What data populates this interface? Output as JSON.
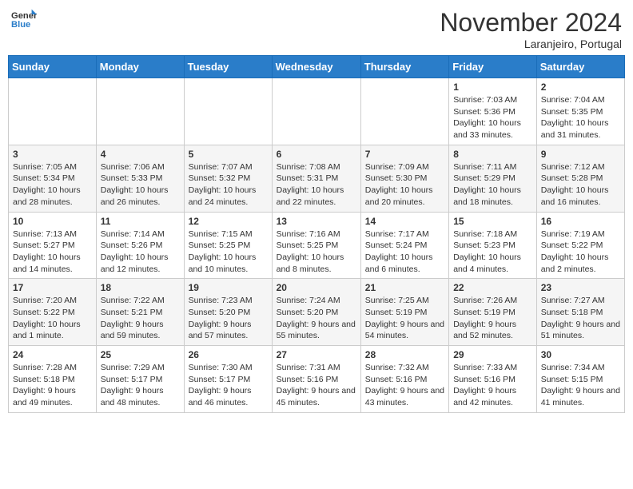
{
  "header": {
    "logo_general": "General",
    "logo_blue": "Blue",
    "month": "November 2024",
    "location": "Laranjeiro, Portugal"
  },
  "days_of_week": [
    "Sunday",
    "Monday",
    "Tuesday",
    "Wednesday",
    "Thursday",
    "Friday",
    "Saturday"
  ],
  "weeks": [
    [
      {
        "day": "",
        "info": ""
      },
      {
        "day": "",
        "info": ""
      },
      {
        "day": "",
        "info": ""
      },
      {
        "day": "",
        "info": ""
      },
      {
        "day": "",
        "info": ""
      },
      {
        "day": "1",
        "info": "Sunrise: 7:03 AM\nSunset: 5:36 PM\nDaylight: 10 hours and 33 minutes."
      },
      {
        "day": "2",
        "info": "Sunrise: 7:04 AM\nSunset: 5:35 PM\nDaylight: 10 hours and 31 minutes."
      }
    ],
    [
      {
        "day": "3",
        "info": "Sunrise: 7:05 AM\nSunset: 5:34 PM\nDaylight: 10 hours and 28 minutes."
      },
      {
        "day": "4",
        "info": "Sunrise: 7:06 AM\nSunset: 5:33 PM\nDaylight: 10 hours and 26 minutes."
      },
      {
        "day": "5",
        "info": "Sunrise: 7:07 AM\nSunset: 5:32 PM\nDaylight: 10 hours and 24 minutes."
      },
      {
        "day": "6",
        "info": "Sunrise: 7:08 AM\nSunset: 5:31 PM\nDaylight: 10 hours and 22 minutes."
      },
      {
        "day": "7",
        "info": "Sunrise: 7:09 AM\nSunset: 5:30 PM\nDaylight: 10 hours and 20 minutes."
      },
      {
        "day": "8",
        "info": "Sunrise: 7:11 AM\nSunset: 5:29 PM\nDaylight: 10 hours and 18 minutes."
      },
      {
        "day": "9",
        "info": "Sunrise: 7:12 AM\nSunset: 5:28 PM\nDaylight: 10 hours and 16 minutes."
      }
    ],
    [
      {
        "day": "10",
        "info": "Sunrise: 7:13 AM\nSunset: 5:27 PM\nDaylight: 10 hours and 14 minutes."
      },
      {
        "day": "11",
        "info": "Sunrise: 7:14 AM\nSunset: 5:26 PM\nDaylight: 10 hours and 12 minutes."
      },
      {
        "day": "12",
        "info": "Sunrise: 7:15 AM\nSunset: 5:25 PM\nDaylight: 10 hours and 10 minutes."
      },
      {
        "day": "13",
        "info": "Sunrise: 7:16 AM\nSunset: 5:25 PM\nDaylight: 10 hours and 8 minutes."
      },
      {
        "day": "14",
        "info": "Sunrise: 7:17 AM\nSunset: 5:24 PM\nDaylight: 10 hours and 6 minutes."
      },
      {
        "day": "15",
        "info": "Sunrise: 7:18 AM\nSunset: 5:23 PM\nDaylight: 10 hours and 4 minutes."
      },
      {
        "day": "16",
        "info": "Sunrise: 7:19 AM\nSunset: 5:22 PM\nDaylight: 10 hours and 2 minutes."
      }
    ],
    [
      {
        "day": "17",
        "info": "Sunrise: 7:20 AM\nSunset: 5:22 PM\nDaylight: 10 hours and 1 minute."
      },
      {
        "day": "18",
        "info": "Sunrise: 7:22 AM\nSunset: 5:21 PM\nDaylight: 9 hours and 59 minutes."
      },
      {
        "day": "19",
        "info": "Sunrise: 7:23 AM\nSunset: 5:20 PM\nDaylight: 9 hours and 57 minutes."
      },
      {
        "day": "20",
        "info": "Sunrise: 7:24 AM\nSunset: 5:20 PM\nDaylight: 9 hours and 55 minutes."
      },
      {
        "day": "21",
        "info": "Sunrise: 7:25 AM\nSunset: 5:19 PM\nDaylight: 9 hours and 54 minutes."
      },
      {
        "day": "22",
        "info": "Sunrise: 7:26 AM\nSunset: 5:19 PM\nDaylight: 9 hours and 52 minutes."
      },
      {
        "day": "23",
        "info": "Sunrise: 7:27 AM\nSunset: 5:18 PM\nDaylight: 9 hours and 51 minutes."
      }
    ],
    [
      {
        "day": "24",
        "info": "Sunrise: 7:28 AM\nSunset: 5:18 PM\nDaylight: 9 hours and 49 minutes."
      },
      {
        "day": "25",
        "info": "Sunrise: 7:29 AM\nSunset: 5:17 PM\nDaylight: 9 hours and 48 minutes."
      },
      {
        "day": "26",
        "info": "Sunrise: 7:30 AM\nSunset: 5:17 PM\nDaylight: 9 hours and 46 minutes."
      },
      {
        "day": "27",
        "info": "Sunrise: 7:31 AM\nSunset: 5:16 PM\nDaylight: 9 hours and 45 minutes."
      },
      {
        "day": "28",
        "info": "Sunrise: 7:32 AM\nSunset: 5:16 PM\nDaylight: 9 hours and 43 minutes."
      },
      {
        "day": "29",
        "info": "Sunrise: 7:33 AM\nSunset: 5:16 PM\nDaylight: 9 hours and 42 minutes."
      },
      {
        "day": "30",
        "info": "Sunrise: 7:34 AM\nSunset: 5:15 PM\nDaylight: 9 hours and 41 minutes."
      }
    ]
  ]
}
